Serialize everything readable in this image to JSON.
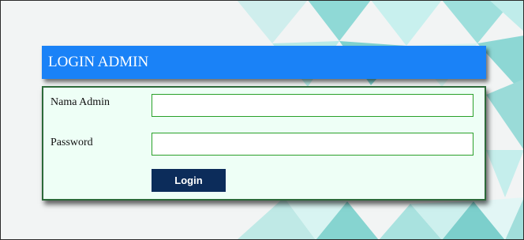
{
  "header": {
    "title": "LOGIN ADMIN"
  },
  "form": {
    "username_label": "Nama Admin",
    "username_value": "",
    "password_label": "Password",
    "password_value": "",
    "login_label": "Login"
  },
  "colors": {
    "header_bg": "#1a82f7",
    "panel_bg": "#eefff6",
    "panel_border": "#2d6a3a",
    "field_border": "#2aa02a",
    "button_bg": "#0c2c5a",
    "background_pattern": "#a9e6e2"
  }
}
